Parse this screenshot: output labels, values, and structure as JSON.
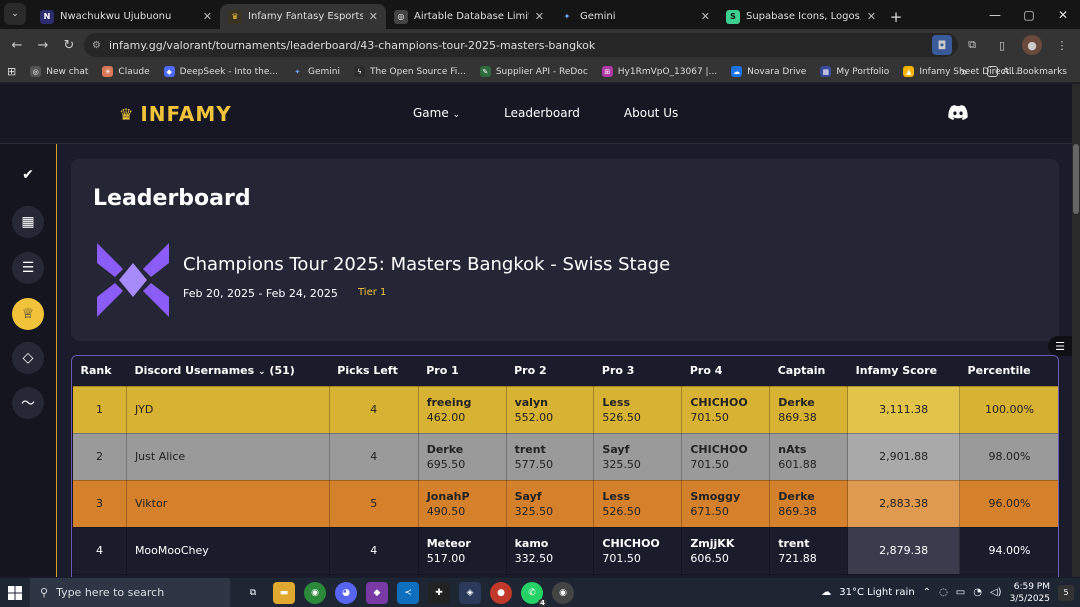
{
  "browser": {
    "tabs": [
      {
        "title": "Nwachukwu Ujubuonu",
        "fav": "N"
      },
      {
        "title": "Infamy Fantasy Esports - Premi",
        "fav": "I",
        "active": true
      },
      {
        "title": "Airtable Database Limitations",
        "fav": "A"
      },
      {
        "title": "Gemini",
        "fav": "✦"
      },
      {
        "title": "Supabase Icons, Logos, Symbo",
        "fav": "S"
      }
    ],
    "url": "infamy.gg/valorant/tournaments/leaderboard/43-champions-tour-2025-masters-bangkok",
    "bookmarks": [
      {
        "label": "New chat",
        "color": "#333"
      },
      {
        "label": "Claude",
        "color": "#d97757"
      },
      {
        "label": "DeepSeek - Into the...",
        "color": "#4d6bfe"
      },
      {
        "label": "Gemini",
        "color": "#4285f4"
      },
      {
        "label": "The Open Source Fi...",
        "color": "#2b2b2b"
      },
      {
        "label": "Supplier API - ReDoc",
        "color": "#2d6b3c"
      },
      {
        "label": "Hy1RmVpO_13067 |...",
        "color": "#b03aa6"
      },
      {
        "label": "Novara Drive",
        "color": "#1a73e8"
      },
      {
        "label": "My Portfolio",
        "color": "#3a4a9a"
      },
      {
        "label": "Infamy Sheet Direct...",
        "color": "#f4b400"
      }
    ],
    "more_bookmarks": "»",
    "all_bookmarks": "All Bookmarks"
  },
  "site": {
    "logo": "INFAMY",
    "nav": {
      "game": "Game",
      "leaderboard": "Leaderboard",
      "about": "About Us"
    },
    "page_title": "Leaderboard",
    "event": {
      "title": "Champions Tour 2025: Masters Bangkok - Swiss Stage",
      "dates": "Feb 20, 2025 - Feb 24, 2025",
      "tier": "Tier 1"
    },
    "table": {
      "headers": {
        "rank": "Rank",
        "users": "Discord Usernames",
        "users_count": "(51)",
        "picks": "Picks Left",
        "pro1": "Pro 1",
        "pro2": "Pro 2",
        "pro3": "Pro 3",
        "pro4": "Pro 4",
        "captain": "Captain",
        "score": "Infamy Score",
        "percentile": "Percentile"
      },
      "rows": [
        {
          "rank": "1",
          "user": "JYD",
          "picks": "4",
          "p1n": "freeing",
          "p1s": "462.00",
          "p2n": "valyn",
          "p2s": "552.00",
          "p3n": "Less",
          "p3s": "526.50",
          "p4n": "CHICHOO",
          "p4s": "701.50",
          "cn": "Derke",
          "cs": "869.38",
          "score": "3,111.38",
          "pct": "100.00%"
        },
        {
          "rank": "2",
          "user": "Just Alice",
          "picks": "4",
          "p1n": "Derke",
          "p1s": "695.50",
          "p2n": "trent",
          "p2s": "577.50",
          "p3n": "Sayf",
          "p3s": "325.50",
          "p4n": "CHICHOO",
          "p4s": "701.50",
          "cn": "nAts",
          "cs": "601.88",
          "score": "2,901.88",
          "pct": "98.00%"
        },
        {
          "rank": "3",
          "user": "Viktor",
          "picks": "5",
          "p1n": "JonahP",
          "p1s": "490.50",
          "p2n": "Sayf",
          "p2s": "325.50",
          "p3n": "Less",
          "p3s": "526.50",
          "p4n": "Smoggy",
          "p4s": "671.50",
          "cn": "Derke",
          "cs": "869.38",
          "score": "2,883.38",
          "pct": "96.00%"
        },
        {
          "rank": "4",
          "user": "MooMooChey",
          "picks": "4",
          "p1n": "Meteor",
          "p1s": "517.00",
          "p2n": "kamo",
          "p2s": "332.50",
          "p3n": "CHICHOO",
          "p3s": "701.50",
          "p4n": "ZmjjKK",
          "p4s": "606.50",
          "cn": "trent",
          "cs": "721.88",
          "score": "2,879.38",
          "pct": "94.00%"
        }
      ]
    }
  },
  "taskbar": {
    "search_placeholder": "Type here to search",
    "weather": "31°C  Light rain",
    "time": "6:59 PM",
    "date": "3/5/2025",
    "notif_count": "5",
    "whatsapp_badge": "4"
  },
  "colors": {
    "accent": "#f1c33a",
    "gold_row": "#d7b233",
    "gold_score": "#e2c44a",
    "silver_row": "#9a9a9a",
    "silver_score": "#a9a9a9",
    "bronze_row": "#d5812c",
    "bronze_score": "#df9a4f",
    "dark_row": "#1b1c2b",
    "dark_score": "#3a3c4d"
  }
}
